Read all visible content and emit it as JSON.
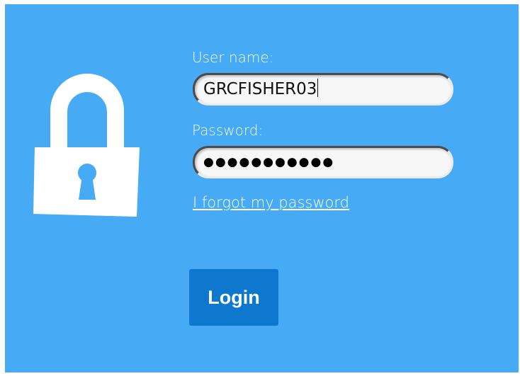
{
  "colors": {
    "panel_background": "#46aaf4",
    "button_background": "#0d78cd",
    "text": "#ffffff"
  },
  "lock": {
    "icon": "lock-icon"
  },
  "form": {
    "username_label": "User name:",
    "username_value": "GRCFISHER03",
    "password_label": "Password:",
    "password_masked": "●●●●●●●●●●●",
    "forgot_link": "I forgot my password",
    "login_button": "Login"
  }
}
